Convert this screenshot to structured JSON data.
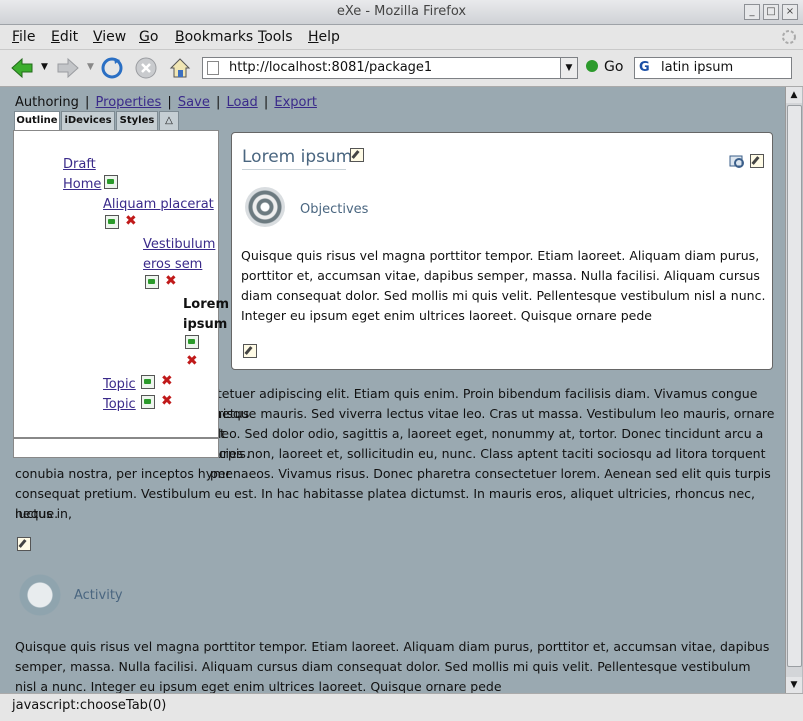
{
  "window": {
    "title": "eXe - Mozilla Firefox"
  },
  "menu": [
    {
      "label": "File",
      "key": "F"
    },
    {
      "label": "Edit",
      "key": "E"
    },
    {
      "label": "View",
      "key": "V"
    },
    {
      "label": "Go",
      "key": "G"
    },
    {
      "label": "Bookmarks",
      "key": "B"
    },
    {
      "label": "Tools",
      "key": "T"
    },
    {
      "label": "Help",
      "key": "H"
    }
  ],
  "nav": {
    "url": "http://localhost:8081/package1",
    "go_label": "Go",
    "search_value": "latin ipsum"
  },
  "toolbar": {
    "authoring": "Authoring",
    "separator": "|",
    "links": [
      "Properties",
      "Save",
      "Load",
      "Export"
    ]
  },
  "tabs": [
    "Outline",
    "iDevices",
    "Styles",
    "△"
  ],
  "outline": {
    "draft_home": "Draft Home",
    "draft_line1": "Draft",
    "draft_line2": "Home",
    "aliquam": "Aliquam placerat",
    "vest_line1": "Vestibulum",
    "vest_line2": "eros sem",
    "lorem_line1": "Lorem",
    "lorem_line2": "ipsum",
    "topic1": "Topic",
    "topic2": "Topic"
  },
  "panel": {
    "title": "Lorem ipsum",
    "objectives_label": "Objectives",
    "text": "Quisque quis risus vel magna porttitor tempor. Etiam laoreet. Aliquam diam purus, porttitor et, accumsan vitae, dapibus semper, massa. Nulla facilisi. Aliquam cursus diam consequat dolor. Sed mollis mi quis velit. Pellentesque vestibulum nisl a nunc. Integer eu ipsum eget enim ultrices laoreet. Quisque ornare pede"
  },
  "body": {
    "line1": "ctetuer adipiscing elit. Etiam quis enim. Proin bibendum facilisis diam. Vivamus congue metus",
    "line2": "erisque mauris. Sed viverra lectus vitae leo. Cras ut massa. Vestibulum leo mauris, ornare sit",
    "line3": ", leo. Sed dolor odio, sagittis a, laoreet eget, nonummy at, tortor. Donec tincidunt arcu a turpis.",
    "line4": "ricies non, laoreet et, sollicitudin eu, nunc. Class aptent taciti sociosqu ad litora torquent per",
    "line5": "conubia nostra, per inceptos hymenaeos. Vivamus risus. Donec pharetra consectetuer lorem. Aenean sed elit quis turpis",
    "line6": "consequat pretium. Vestibulum eu est. In hac habitasse platea dictumst. In mauris eros, aliquet ultricies, rhoncus nec, luctus in,",
    "line7": "neque.",
    "activity_label": "Activity",
    "activity_text": "Quisque quis risus vel magna porttitor tempor. Etiam laoreet. Aliquam diam purus, porttitor et, accumsan vitae, dapibus semper, massa. Nulla facilisi. Aliquam cursus diam consequat dolor. Sed mollis mi quis velit. Pellentesque vestibulum nisl a nunc. Integer eu ipsum eget enim ultrices laoreet. Quisque ornare pede"
  },
  "status": {
    "text": "javascript:chooseTab(0)"
  }
}
